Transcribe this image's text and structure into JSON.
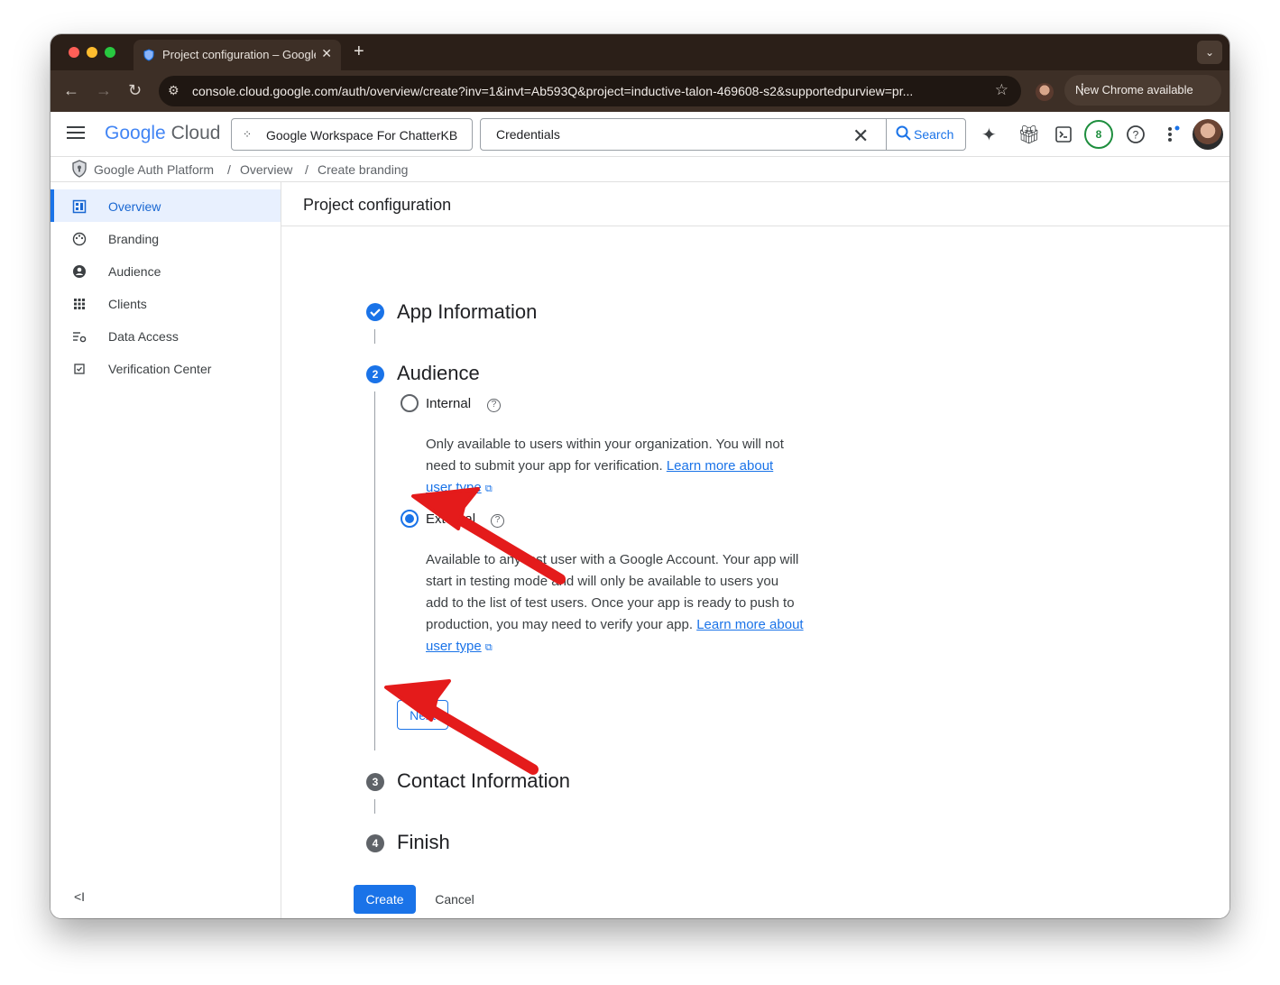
{
  "browser": {
    "tab_title": "Project configuration – Google Cloud",
    "new_tab_symbol": "+",
    "close_symbol": "✕",
    "url": "console.cloud.google.com/auth/overview/create?inv=1&invt=Ab593Q&project=inductive-talon-469608-s2&supportedpurview=pr...",
    "update_label": "New Chrome available"
  },
  "header": {
    "logo_google": "Google",
    "logo_cloud": "Cloud",
    "project_name": "Google Workspace For ChatterKB",
    "search_value": "Credentials",
    "search_button": "Search",
    "notifications_count": "8"
  },
  "breadcrumb": {
    "items": [
      "Google Auth Platform",
      "Overview",
      "Create branding"
    ],
    "separator": "/"
  },
  "sidebar": {
    "items": [
      {
        "label": "Overview",
        "icon": "dashboard-icon"
      },
      {
        "label": "Branding",
        "icon": "palette-icon"
      },
      {
        "label": "Audience",
        "icon": "account-circle-icon"
      },
      {
        "label": "Clients",
        "icon": "apps-grid-icon"
      },
      {
        "label": "Data Access",
        "icon": "data-settings-icon"
      },
      {
        "label": "Verification Center",
        "icon": "check-box-icon"
      }
    ],
    "collapse_symbol": "<I"
  },
  "main": {
    "page_title": "Project configuration",
    "steps": [
      {
        "number": "",
        "title": "App Information",
        "state": "done"
      },
      {
        "number": "2",
        "title": "Audience",
        "state": "active"
      },
      {
        "number": "3",
        "title": "Contact Information",
        "state": "pending"
      },
      {
        "number": "4",
        "title": "Finish",
        "state": "pending"
      }
    ],
    "audience": {
      "internal": {
        "label": "Internal",
        "desc_line1": "Only available to users within your organization. You will not",
        "desc_line2": "need to submit your app for verification.",
        "link1": "Learn more about",
        "link2": "user type",
        "checked": false
      },
      "external": {
        "label": "External",
        "desc_line1": "Available to any test user with a Google Account. Your app will",
        "desc_line2": "start in testing mode and will only be available to users you",
        "desc_line3": "add to the list of test users. Once your app is ready to push to",
        "desc_line4": "production, you may need to verify your app.",
        "link1": "Learn more about",
        "link2": "user type",
        "checked": true
      }
    },
    "next_label": "Next",
    "create_label": "Create",
    "cancel_label": "Cancel"
  },
  "colors": {
    "accent": "#1a73e8",
    "annotation": "#e41b1b",
    "browser_chrome": "#3d2f26"
  }
}
